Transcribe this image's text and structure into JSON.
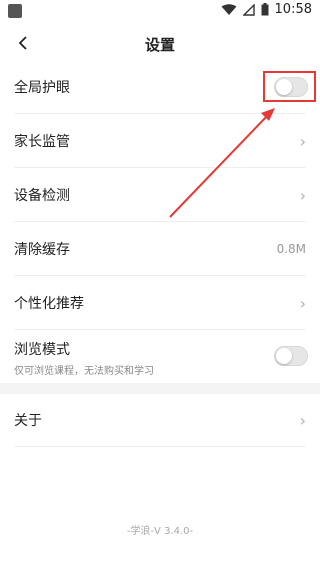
{
  "status": {
    "time": "10:58"
  },
  "header": {
    "title": "设置"
  },
  "rows": {
    "eye_care": {
      "label": "全局护眼"
    },
    "parental": {
      "label": "家长监管"
    },
    "device_check": {
      "label": "设备检测"
    },
    "clear_cache": {
      "label": "清除缓存",
      "value": "0.8M"
    },
    "personalized": {
      "label": "个性化推荐"
    },
    "browse_mode": {
      "label": "浏览模式",
      "sublabel": "仅可浏览课程，无法购买和学习"
    },
    "about": {
      "label": "关于"
    }
  },
  "footer": {
    "version": "-学浪-V 3.4.0-"
  },
  "colors": {
    "highlight": "#e53935",
    "chevron": "#b0b0b0"
  },
  "icons": [
    "back-icon",
    "chevron-right-icon",
    "wifi-icon",
    "signal-icon",
    "battery-icon"
  ]
}
